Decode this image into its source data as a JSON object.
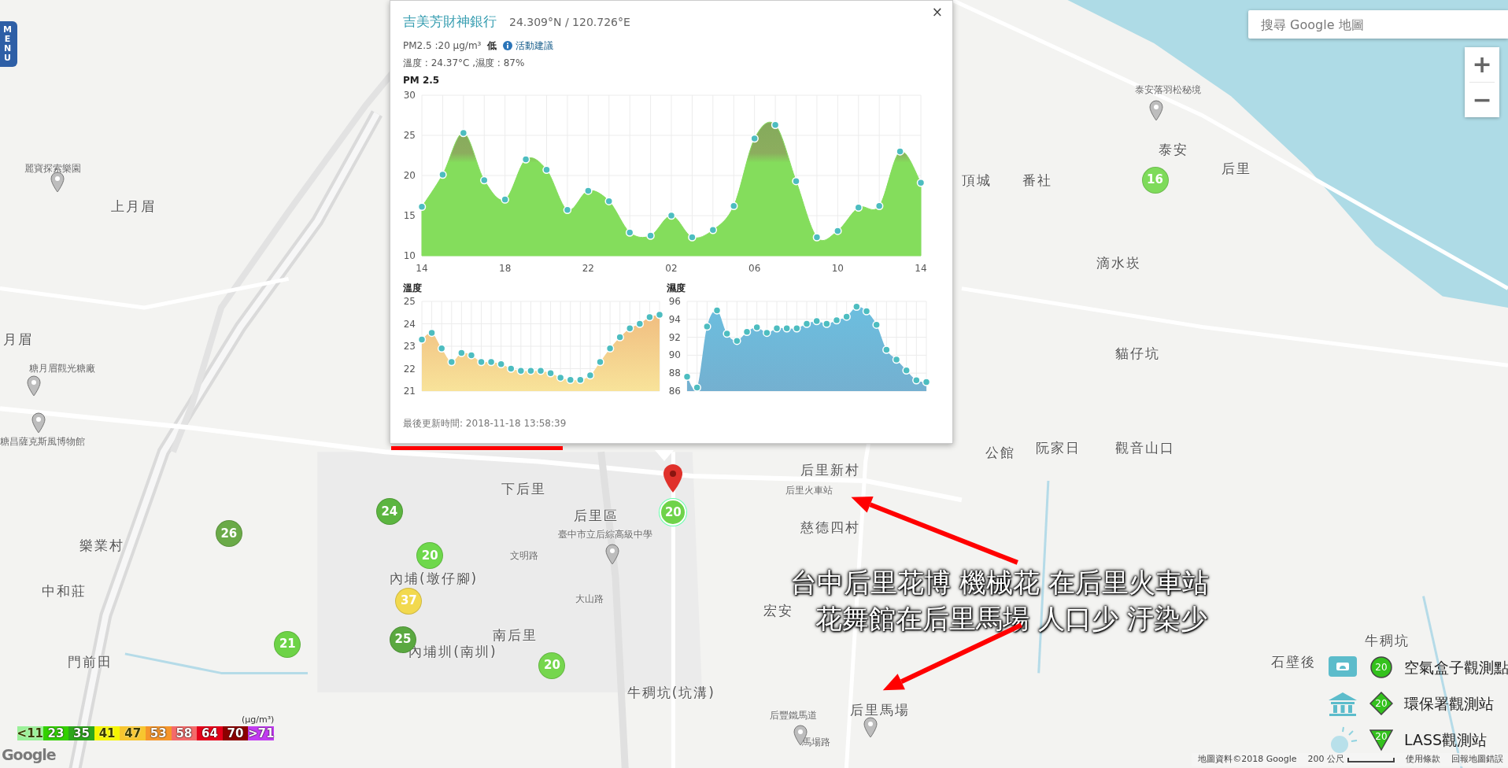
{
  "menu_tab": {
    "label": "MENU"
  },
  "search": {
    "placeholder": "搜尋 Google 地圖"
  },
  "zoom_controls": [
    "+",
    "−"
  ],
  "map_labels": [
    {
      "text": "麗寶探索樂園",
      "kind": "poi"
    },
    {
      "text": "上月眉",
      "kind": "place"
    },
    {
      "text": "月眉",
      "kind": "place"
    },
    {
      "text": "糖月眉觀光糖廠",
      "kind": "poi"
    },
    {
      "text": "糖昌薩克斯風博物館",
      "kind": "poi"
    },
    {
      "text": "樂業村",
      "kind": "place"
    },
    {
      "text": "中和莊",
      "kind": "place"
    },
    {
      "text": "門前田",
      "kind": "place"
    },
    {
      "text": "內埔(墩仔腳)",
      "kind": "place"
    },
    {
      "text": "內埔圳(南圳)",
      "kind": "place"
    },
    {
      "text": "南后里",
      "kind": "place"
    },
    {
      "text": "牛稠坑(坑溝)",
      "kind": "place"
    },
    {
      "text": "下后里",
      "kind": "place"
    },
    {
      "text": "后里區",
      "kind": "place"
    },
    {
      "text": "臺中市立后綜高級中學",
      "kind": "poi"
    },
    {
      "text": "后里新村",
      "kind": "place"
    },
    {
      "text": "后里火車站",
      "kind": "poi"
    },
    {
      "text": "慈德四村",
      "kind": "place"
    },
    {
      "text": "宏安",
      "kind": "place"
    },
    {
      "text": "公館",
      "kind": "place"
    },
    {
      "text": "阮家日",
      "kind": "place"
    },
    {
      "text": "觀音山口",
      "kind": "place"
    },
    {
      "text": "頂城",
      "kind": "place"
    },
    {
      "text": "番社",
      "kind": "place"
    },
    {
      "text": "泰安",
      "kind": "place"
    },
    {
      "text": "后里",
      "kind": "place"
    },
    {
      "text": "泰安落羽松秘境",
      "kind": "poi"
    },
    {
      "text": "滴水崁",
      "kind": "place"
    },
    {
      "text": "貓仔坑",
      "kind": "place"
    },
    {
      "text": "牛稠坑",
      "kind": "place"
    },
    {
      "text": "石壁後",
      "kind": "place"
    },
    {
      "text": "后里馬場",
      "kind": "place"
    },
    {
      "text": "后豐鐵馬道",
      "kind": "poi"
    },
    {
      "text": "馬場路",
      "kind": "poi"
    },
    {
      "text": "文明路",
      "kind": "poi"
    },
    {
      "text": "大山路",
      "kind": "poi"
    }
  ],
  "markers": [
    {
      "value": "16",
      "color": "#7edb5a",
      "selected": false
    },
    {
      "value": "24",
      "color": "#5cb540",
      "selected": false
    },
    {
      "value": "26",
      "color": "#6aaa48",
      "selected": false
    },
    {
      "value": "20",
      "color": "#6ed84b",
      "selected": false
    },
    {
      "value": "37",
      "color": "#f2d94e",
      "selected": false
    },
    {
      "value": "21",
      "color": "#6dd347",
      "selected": false
    },
    {
      "value": "25",
      "color": "#5aa840",
      "selected": false
    },
    {
      "value": "20",
      "color": "#76d64e",
      "selected": false
    },
    {
      "value": "20",
      "color": "#6fd34a",
      "selected": true
    }
  ],
  "popup": {
    "title": "吉美芳財神銀行",
    "coords": "24.309°N / 120.726°E",
    "close": "×",
    "pm_reading": "PM2.5 :20 μg/m³",
    "level": "低",
    "advice_link": "活動建議",
    "weather": "溫度 : 24.37°C ,濕度 : 87%",
    "charts": [
      {
        "chart_data": {
          "type": "area",
          "title": "PM 2.5",
          "categories": [
            "14",
            null,
            null,
            null,
            "18",
            null,
            null,
            null,
            "22",
            null,
            null,
            null,
            "02",
            null,
            null,
            null,
            "06",
            null,
            null,
            null,
            "10",
            null,
            null,
            null,
            "14"
          ],
          "ylim": [
            10,
            30
          ],
          "yticks": [
            10,
            15,
            20,
            25,
            30
          ],
          "grid": true,
          "series": [
            {
              "color": "#84dd5c",
              "values": [
                16.1,
                20.1,
                25.3,
                19.4,
                17.0,
                22.0,
                20.7,
                15.7,
                18.1,
                16.8,
                12.9,
                12.5,
                15.0,
                12.3,
                13.2,
                16.2,
                24.6,
                26.3,
                19.3,
                12.3,
                13.1,
                16.0,
                16.2,
                23.0,
                19.1
              ]
            }
          ]
        }
      },
      {
        "title": "溫度",
        "y_labels": [
          "25",
          "24",
          "23",
          "22",
          "21"
        ]
      },
      {
        "title": "濕度",
        "y_labels": [
          "96",
          "94",
          "92",
          "90",
          "88",
          "86"
        ]
      }
    ],
    "updated": "最後更新時間: 2018-11-18 13:58:39"
  },
  "scale_legend": {
    "unit": "(μg/m³)",
    "items": [
      {
        "label": "<11",
        "color": "#9af098"
      },
      {
        "label": "23",
        "color": "#33d100"
      },
      {
        "label": "35",
        "color": "#2ea61c"
      },
      {
        "label": "41",
        "color": "#f5f500"
      },
      {
        "label": "47",
        "color": "#f7c62f"
      },
      {
        "label": "53",
        "color": "#f6962b"
      },
      {
        "label": "58",
        "color": "#f46a6a"
      },
      {
        "label": "64",
        "color": "#e5001a"
      },
      {
        "label": "70",
        "color": "#8c0000"
      },
      {
        "label": ">71",
        "color": "#c33cf2"
      }
    ]
  },
  "station_legend": [
    {
      "kind": "airbox",
      "value": "20",
      "label": "空氣盒子觀測點"
    },
    {
      "kind": "epa",
      "value": "20",
      "label": "環保署觀測站"
    },
    {
      "kind": "lass",
      "value": "20",
      "label": "LASS觀測站"
    }
  ],
  "logo": "Google",
  "attribution": {
    "data": "地圖資料©2018 Google",
    "scale": "200 公尺",
    "terms": "使用條款",
    "report": "回報地圖錯誤"
  },
  "annotation": {
    "lines": [
      "台中后里花博 機械花 在后里火車站",
      "花舞館在后里馬場 人口少 汙染少"
    ]
  }
}
